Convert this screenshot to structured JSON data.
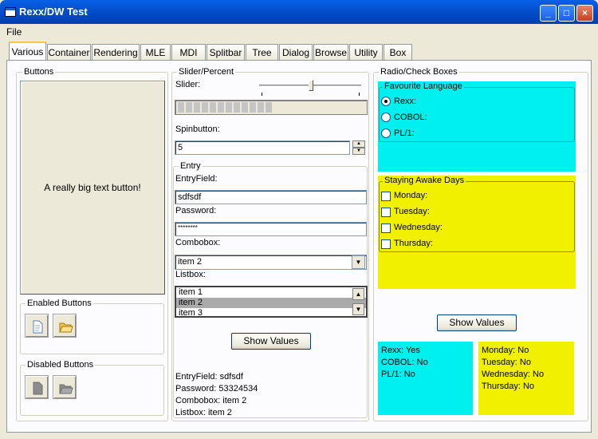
{
  "window": {
    "title": "Rexx/DW Test"
  },
  "menu": [
    "File"
  ],
  "tabs": [
    "Various",
    "Container",
    "Rendering",
    "MLE",
    "MDI",
    "Splitbar",
    "Tree",
    "Dialog",
    "Browse",
    "Utility",
    "Box"
  ],
  "buttons_group": {
    "label": "Buttons",
    "big_button": "A really big text button!",
    "enabled_label": "Enabled Buttons",
    "disabled_label": "Disabled Buttons",
    "enabled_icons": [
      "new-file-icon",
      "open-folder-icon"
    ],
    "disabled_icons": [
      "new-file-icon",
      "open-folder-icon"
    ]
  },
  "slider_group": {
    "label": "Slider/Percent",
    "slider_label": "Slider:",
    "spinbutton_label": "Spinbutton:",
    "spin_value": "5"
  },
  "entry_group": {
    "label": "Entry",
    "entryfield_label": "EntryField:",
    "entryfield_value": "sdfsdf",
    "password_label": "Password:",
    "password_value": "********",
    "combobox_label": "Combobox:",
    "combobox_value": "item 2",
    "listbox_label": "Listbox:",
    "listbox_items": [
      "item 1",
      "item 2",
      "item 3"
    ],
    "show_values": "Show Values"
  },
  "values_readout": {
    "entryfield": "EntryField: sdfsdf",
    "password": "Password: 53324534",
    "combobox": "Combobox: item 2",
    "listbox": "Listbox: item 2"
  },
  "radio_group": {
    "label": "Radio/Check Boxes",
    "language_label": "Favourite Language",
    "languages": [
      "Rexx:",
      "COBOL:",
      "PL/1:"
    ],
    "days_label": "Staying Awake Days",
    "days": [
      "Monday:",
      "Tuesday:",
      "Wednesday:",
      "Thursday:"
    ],
    "show_values": "Show Values",
    "cyan_results": [
      "Rexx: Yes",
      "COBOL: No",
      "PL/1: No"
    ],
    "yellow_results": [
      "Monday: No",
      "Tuesday: No",
      "Wednesday: No",
      "Thursday: No"
    ]
  },
  "colors": {
    "cyan": "#00f0f0",
    "yellow": "#f0f000",
    "title_blue": "#0049c5"
  }
}
